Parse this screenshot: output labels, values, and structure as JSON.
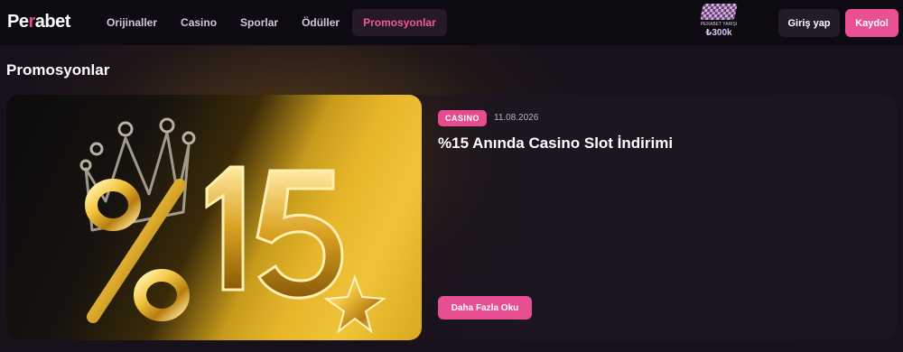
{
  "brand": {
    "logo_prefix": "Pe",
    "logo_accent": "r",
    "logo_suffix": "abet"
  },
  "nav": {
    "items": [
      {
        "label": "Orijinaller"
      },
      {
        "label": "Casino"
      },
      {
        "label": "Sporlar"
      },
      {
        "label": "Ödüller"
      },
      {
        "label": "Promosyonlar",
        "active": true
      }
    ]
  },
  "race": {
    "label": "PERABET YARIŞI",
    "amount": "₺300k",
    "icon": "checkered-flag-icon"
  },
  "auth": {
    "login_label": "Giriş yap",
    "register_label": "Kaydol"
  },
  "page": {
    "title": "Promosyonlar"
  },
  "promo": {
    "tag": "CASINO",
    "date": "11.08.2026",
    "title": "%15 Anında Casino Slot İndirimi",
    "button_label": "Daha Fazla Oku",
    "image_text": "%15"
  },
  "colors": {
    "accent": "#ea4f93",
    "background": "#15101a",
    "gold": "#e6b52a"
  }
}
